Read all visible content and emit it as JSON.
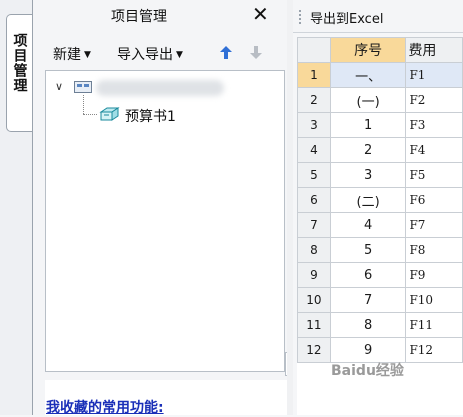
{
  "side_tab": {
    "label": "项目管理"
  },
  "panel": {
    "title": "项目管理",
    "close_glyph": "✕",
    "toolbar": {
      "new_label": "新建",
      "import_export_label": "导入导出"
    },
    "tree": {
      "item_label": "预算书1"
    },
    "favorites_label": "我收藏的常用功能:"
  },
  "export_bar": {
    "button_label": "导出到Excel"
  },
  "grid": {
    "headers": {
      "seq": "序号",
      "fee": "费用"
    },
    "rows": [
      {
        "n": "1",
        "seq": "一、",
        "fee": "F1"
      },
      {
        "n": "2",
        "seq": "(一)",
        "fee": "F2"
      },
      {
        "n": "3",
        "seq": "1",
        "fee": "F3"
      },
      {
        "n": "4",
        "seq": "2",
        "fee": "F4"
      },
      {
        "n": "5",
        "seq": "3",
        "fee": "F5"
      },
      {
        "n": "6",
        "seq": "(二)",
        "fee": "F6"
      },
      {
        "n": "7",
        "seq": "4",
        "fee": "F7"
      },
      {
        "n": "8",
        "seq": "5",
        "fee": "F8"
      },
      {
        "n": "9",
        "seq": "6",
        "fee": "F9"
      },
      {
        "n": "10",
        "seq": "7",
        "fee": "F10"
      },
      {
        "n": "11",
        "seq": "8",
        "fee": "F11"
      },
      {
        "n": "12",
        "seq": "9",
        "fee": "F12"
      }
    ]
  },
  "watermark": "Baidu经验",
  "colors": {
    "accent_header": "#f9d99a",
    "link_blue": "#1a2fb8",
    "arrow_up": "#2f6fd6",
    "arrow_down_disabled": "#b8bdc4"
  },
  "icons": {
    "close": "close-icon",
    "arrow_up": "arrow-up-icon",
    "arrow_down": "arrow-down-icon",
    "tree_root": "project-root-icon",
    "tree_item": "budget-book-icon"
  }
}
